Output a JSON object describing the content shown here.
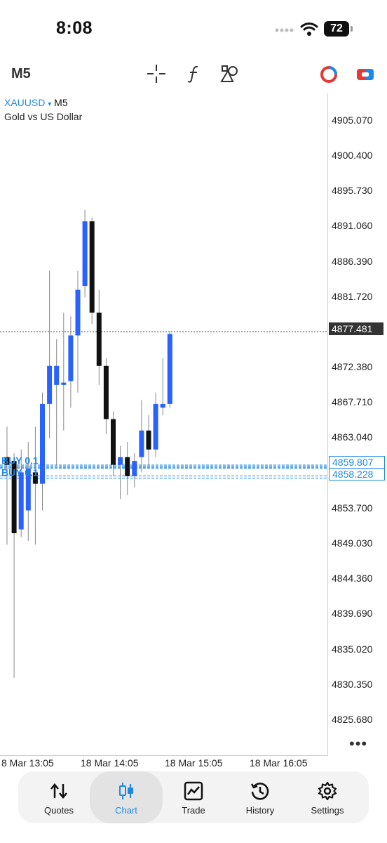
{
  "status": {
    "time": "8:08",
    "battery": "72"
  },
  "toolbar": {
    "timeframe": "M5"
  },
  "chart": {
    "symbol": "XAUUSD",
    "symbol_caret": "▾",
    "timeframe": "M5",
    "description": "Gold vs US Dollar",
    "current_price": "4877.481",
    "order_prices": [
      "4859.807",
      "4858.228"
    ],
    "order_label": "BUY 0.1",
    "price_axis": [
      "4905.070",
      "4900.400",
      "4895.730",
      "4891.060",
      "4886.390",
      "4881.720",
      "4872.380",
      "4867.710",
      "4863.040",
      "4853.700",
      "4849.030",
      "4844.360",
      "4839.690",
      "4835.020",
      "4830.350",
      "4825.680"
    ],
    "time_axis": [
      "8 Mar 13:05",
      "18 Mar 14:05",
      "18 Mar 15:05",
      "18 Mar 16:05"
    ],
    "more": "•••"
  },
  "chart_data": {
    "type": "candlestick",
    "title": "XAUUSD M5",
    "ylim": [
      4822.0,
      4909.0
    ],
    "colors": {
      "up": "#2962ff",
      "down": "#111111"
    },
    "candles": [
      {
        "o": 4861.0,
        "h": 4865.0,
        "l": 4849.5,
        "c": 4860.0
      },
      {
        "o": 4860.5,
        "h": 4861.5,
        "l": 4832.0,
        "c": 4851.0
      },
      {
        "o": 4851.5,
        "h": 4862.0,
        "l": 4850.5,
        "c": 4859.0
      },
      {
        "o": 4854.0,
        "h": 4863.0,
        "l": 4850.0,
        "c": 4859.5
      },
      {
        "o": 4859.0,
        "h": 4865.0,
        "l": 4849.5,
        "c": 4857.5
      },
      {
        "o": 4857.5,
        "h": 4869.5,
        "l": 4854.0,
        "c": 4868.0
      },
      {
        "o": 4868.0,
        "h": 4885.5,
        "l": 4863.5,
        "c": 4873.0
      },
      {
        "o": 4870.5,
        "h": 4876.5,
        "l": 4860.0,
        "c": 4873.0
      },
      {
        "o": 4870.5,
        "h": 4880.0,
        "l": 4864.5,
        "c": 4870.8
      },
      {
        "o": 4871.0,
        "h": 4879.5,
        "l": 4867.5,
        "c": 4877.0
      },
      {
        "o": 4877.0,
        "h": 4885.5,
        "l": 4869.5,
        "c": 4883.0
      },
      {
        "o": 4883.5,
        "h": 4893.5,
        "l": 4882.0,
        "c": 4892.0
      },
      {
        "o": 4892.0,
        "h": 4892.5,
        "l": 4878.5,
        "c": 4880.0
      },
      {
        "o": 4880.0,
        "h": 4883.0,
        "l": 4870.5,
        "c": 4873.0
      },
      {
        "o": 4873.0,
        "h": 4874.0,
        "l": 4864.0,
        "c": 4866.0
      },
      {
        "o": 4866.0,
        "h": 4867.0,
        "l": 4858.5,
        "c": 4860.0
      },
      {
        "o": 4860.0,
        "h": 4862.5,
        "l": 4855.5,
        "c": 4861.0
      },
      {
        "o": 4861.0,
        "h": 4863.0,
        "l": 4856.0,
        "c": 4858.5
      },
      {
        "o": 4858.5,
        "h": 4861.5,
        "l": 4857.0,
        "c": 4860.5
      },
      {
        "o": 4861.0,
        "h": 4868.5,
        "l": 4859.0,
        "c": 4864.5
      },
      {
        "o": 4864.5,
        "h": 4866.5,
        "l": 4860.0,
        "c": 4862.0
      },
      {
        "o": 4862.0,
        "h": 4869.5,
        "l": 4861.0,
        "c": 4868.0
      },
      {
        "o": 4867.5,
        "h": 4874.0,
        "l": 4866.5,
        "c": 4868.0
      },
      {
        "o": 4868.0,
        "h": 4877.5,
        "l": 4867.5,
        "c": 4877.2
      }
    ]
  },
  "tabs": [
    {
      "label": "Quotes",
      "icon": "quotes-arrows-icon"
    },
    {
      "label": "Chart",
      "icon": "candles-icon",
      "active": true
    },
    {
      "label": "Trade",
      "icon": "trend-chart-icon"
    },
    {
      "label": "History",
      "icon": "history-clock-icon"
    },
    {
      "label": "Settings",
      "icon": "gear-icon"
    }
  ]
}
